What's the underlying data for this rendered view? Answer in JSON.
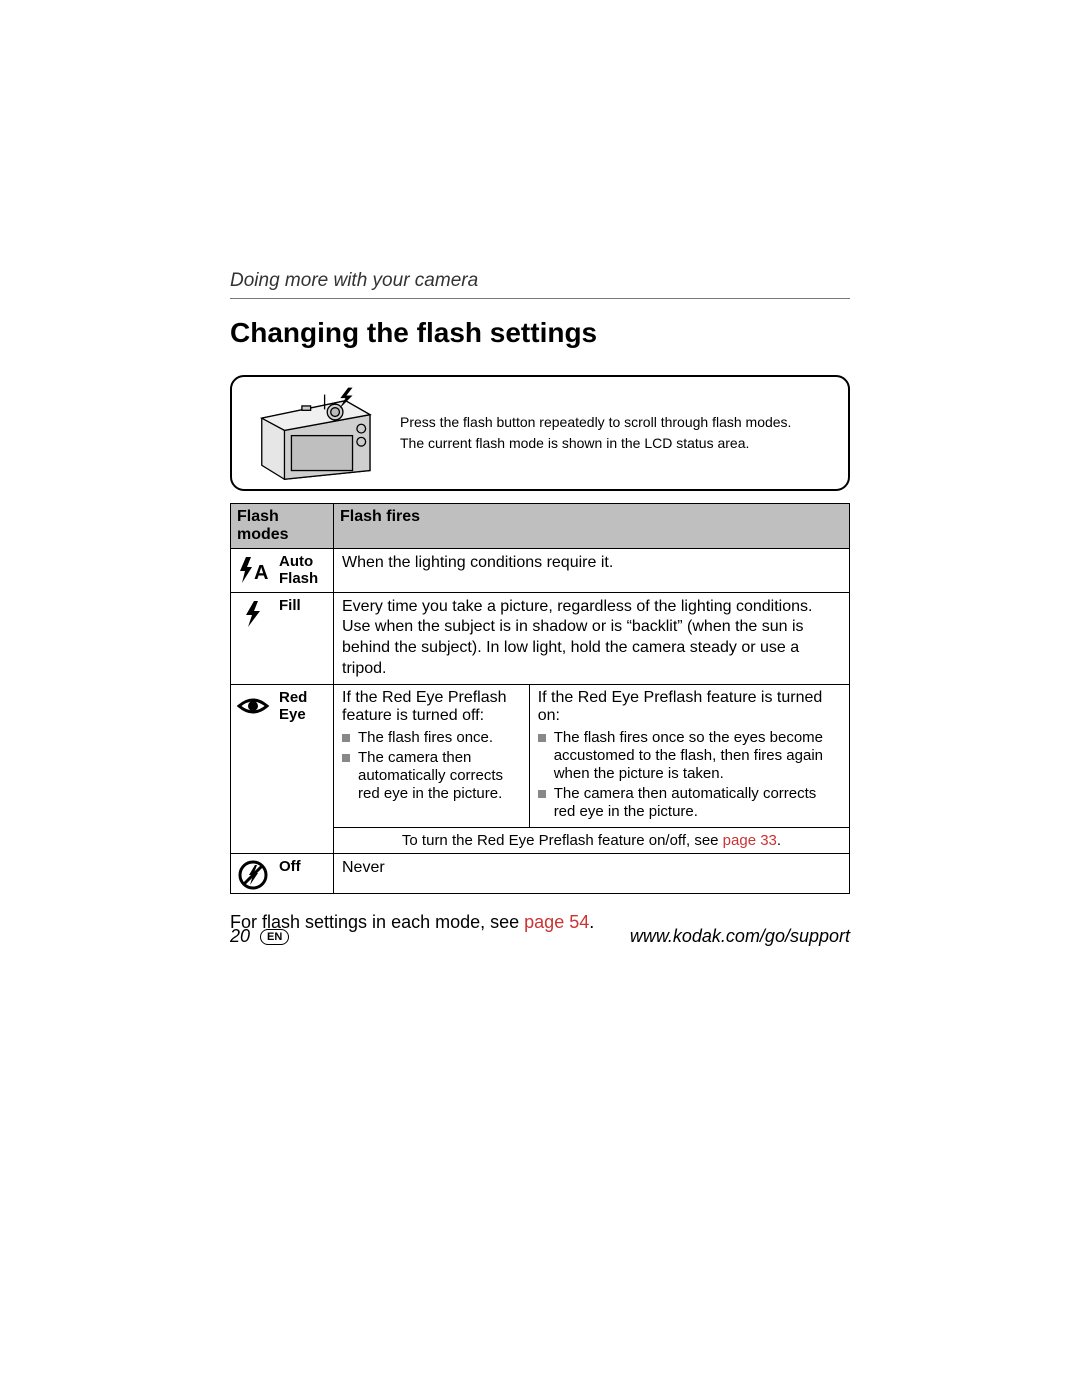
{
  "section_label": "Doing more with your camera",
  "heading": "Changing the flash settings",
  "figure": {
    "line1": "Press the flash button repeatedly to scroll through flash modes.",
    "line2": "The current flash mode is shown in the LCD status area."
  },
  "table": {
    "header_modes": "Flash modes",
    "header_fires": "Flash fires",
    "rows": {
      "auto": {
        "label": "Auto Flash",
        "desc": "When the lighting conditions require it."
      },
      "fill": {
        "label": "Fill",
        "desc": "Every time you take a picture, regardless of the lighting conditions. Use when the subject is in shadow or is “backlit” (when the sun is behind the subject). In low light, hold the camera steady or use a tripod."
      },
      "redeye": {
        "label": "Red Eye",
        "off_title": "If the Red Eye Preflash feature is turned off:",
        "off_b1": "The flash fires once.",
        "off_b2": "The camera then automatically corrects red eye in the picture.",
        "on_title": "If the Red Eye Preflash feature is turned on:",
        "on_b1": "The flash fires once so the eyes become accustomed to the flash, then fires again when the picture is taken.",
        "on_b2": "The camera then automatically corrects red eye in the picture.",
        "toggle_prefix": "To turn the Red Eye Preflash feature on/off, see ",
        "toggle_link": "page 33",
        "toggle_suffix": "."
      },
      "off": {
        "label": "Off",
        "desc": "Never"
      }
    }
  },
  "after_prefix": "For flash settings in each mode, see ",
  "after_link": "page 54",
  "after_suffix": ".",
  "footer": {
    "page": "20",
    "lang": "EN",
    "url": "www.kodak.com/go/support"
  }
}
